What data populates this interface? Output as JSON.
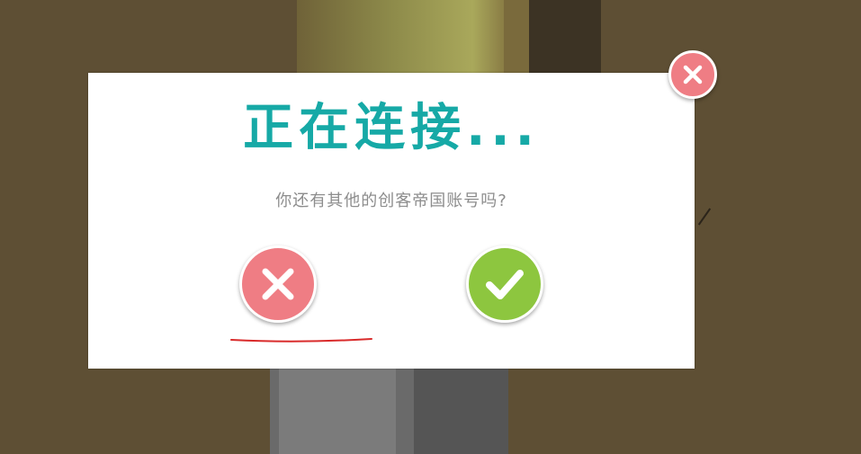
{
  "dialog": {
    "title": "正在连接...",
    "message": "你还有其他的创客帝国账号吗?",
    "close_icon": "close-icon",
    "cancel_icon": "x-icon",
    "confirm_icon": "checkmark-icon"
  },
  "colors": {
    "title": "#16a9a6",
    "message": "#8d8d8d",
    "cancel": "#ef7d84",
    "confirm": "#8dc63f",
    "close": "#ef7d84",
    "annotation": "#d92b2b",
    "background": "#5e4f34"
  }
}
